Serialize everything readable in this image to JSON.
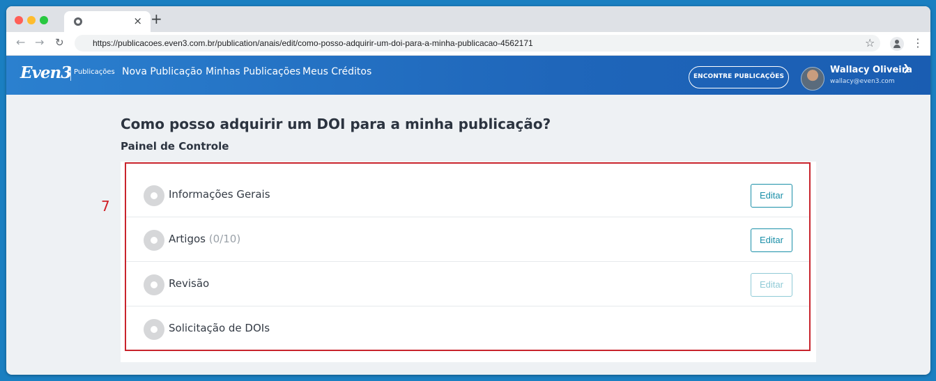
{
  "browser": {
    "tab_close": "×",
    "new_tab": "+",
    "url": "https://publicacoes.even3.com.br/publication/anais/edit/como-posso-adquirir-um-doi-para-a-minha-publicacao-4562171",
    "icons": [
      "back-arrow-icon",
      "forward-arrow-icon",
      "reload-icon",
      "star-icon",
      "profile-icon",
      "menu-dots-icon"
    ]
  },
  "header": {
    "logo": "Even3",
    "logo_sub": "Publicações",
    "nav": [
      "Nova Publicação",
      "Minhas Publicações",
      "Meus Créditos"
    ],
    "find_button": "ENCONTRE PUBLICAÇÕES",
    "user_name": "Wallacy Oliveira",
    "user_email": "wallacy@even3.com"
  },
  "main": {
    "title": "Como posso adquirir um DOI para a minha publicação?",
    "section_title": "Painel de Controle",
    "annotation": "7",
    "steps": [
      {
        "label": "Informações Gerais",
        "count": "",
        "button": "Editar",
        "button_enabled": true
      },
      {
        "label": "Artigos",
        "count": "(0/10)",
        "button": "Editar",
        "button_enabled": true
      },
      {
        "label": "Revisão",
        "count": "",
        "button": "Editar",
        "button_enabled": false
      },
      {
        "label": "Solicitação de DOIs",
        "count": "",
        "button": "",
        "button_enabled": false
      }
    ]
  },
  "colors": {
    "page_bg": "#1a7fc1",
    "header_blue": "#2b80cf",
    "accent_teal": "#1a8fa8",
    "highlight_red": "#c8232c"
  }
}
